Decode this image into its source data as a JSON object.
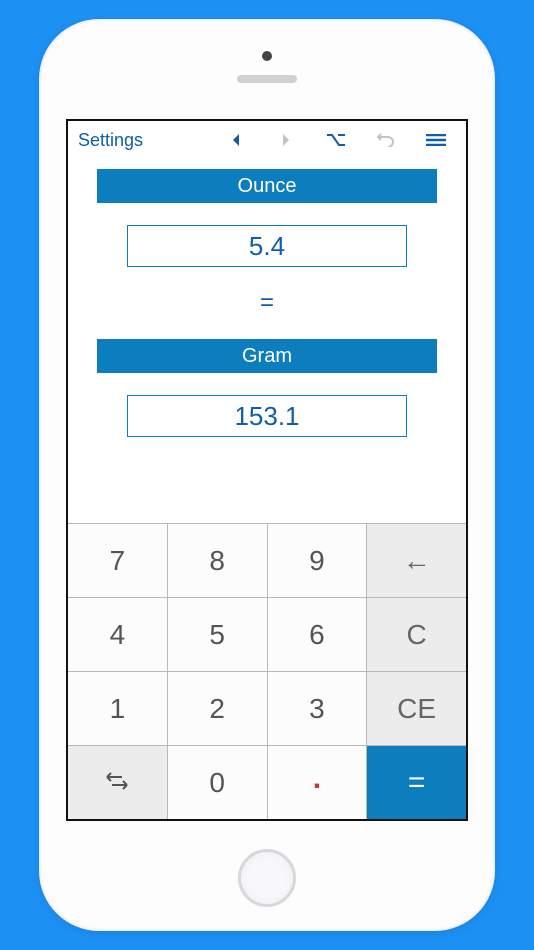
{
  "toolbar": {
    "settings_label": "Settings"
  },
  "conversion": {
    "source_unit": "Ounce",
    "source_value": "5.4",
    "equals": "=",
    "target_unit": "Gram",
    "target_value": "153.1"
  },
  "keypad": {
    "k7": "7",
    "k8": "8",
    "k9": "9",
    "back": "←",
    "k4": "4",
    "k5": "5",
    "k6": "6",
    "clear": "C",
    "k1": "1",
    "k2": "2",
    "k3": "3",
    "clear_entry": "CE",
    "k0": "0",
    "dot": ".",
    "equals": "="
  }
}
